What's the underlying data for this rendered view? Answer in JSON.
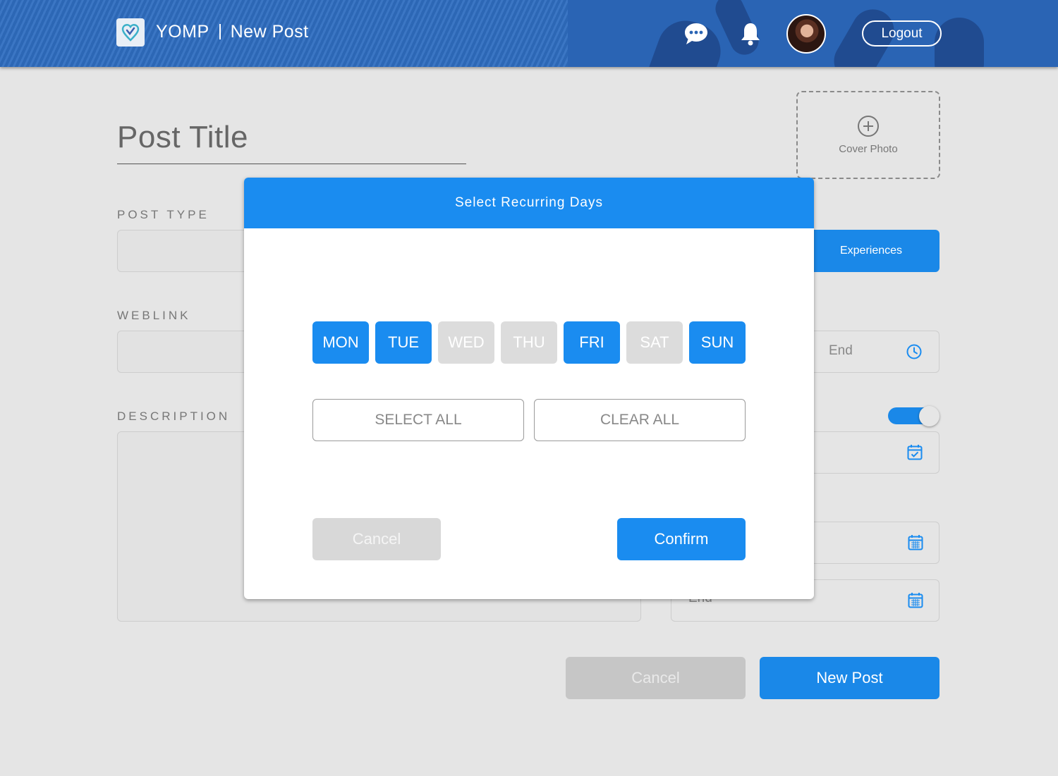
{
  "header": {
    "app_name": "YOMP",
    "page_name": "New Post",
    "logout_label": "Logout",
    "icons": {
      "logo": "yomp-logo-icon",
      "chat": "chat-bubble-icon",
      "notifications": "bell-icon",
      "avatar": "user-avatar"
    }
  },
  "form": {
    "title_placeholder": "Post Title",
    "cover_photo_label": "Cover Photo",
    "post_type_label": "POST TYPE",
    "post_type_selected": "Experiences",
    "weblink_label": "WEBLINK",
    "time_end_placeholder": "End",
    "description_label": "DESCRIPTION",
    "date_end_placeholder": "End",
    "recurring_toggle_on": true,
    "cancel_label": "Cancel",
    "submit_label": "New Post"
  },
  "modal": {
    "title": "Select Recurring Days",
    "days": [
      {
        "label": "MON",
        "selected": true
      },
      {
        "label": "TUE",
        "selected": true
      },
      {
        "label": "WED",
        "selected": false
      },
      {
        "label": "THU",
        "selected": false
      },
      {
        "label": "FRI",
        "selected": true
      },
      {
        "label": "SAT",
        "selected": false
      },
      {
        "label": "SUN",
        "selected": true
      }
    ],
    "select_all_label": "SELECT ALL",
    "clear_all_label": "CLEAR ALL",
    "cancel_label": "Cancel",
    "confirm_label": "Confirm"
  },
  "colors": {
    "accent": "#1a8cf0",
    "header_bg": "#2a64b4",
    "disabled": "#dcdcdc",
    "page_bg": "#e5e5e5"
  }
}
